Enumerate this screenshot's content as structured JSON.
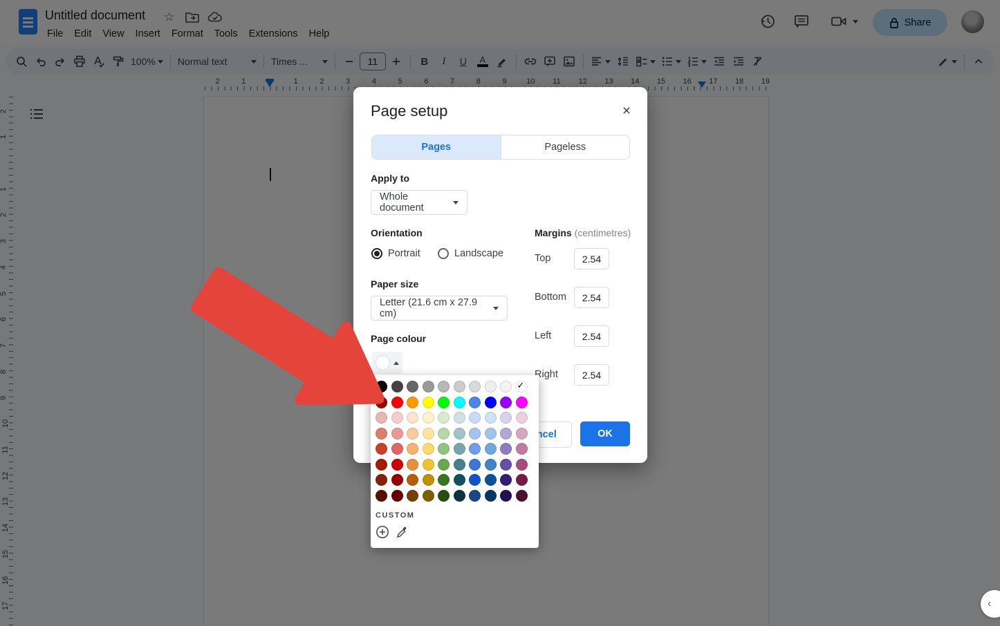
{
  "header": {
    "doc_title": "Untitled document",
    "menus": [
      "File",
      "Edit",
      "View",
      "Insert",
      "Format",
      "Tools",
      "Extensions",
      "Help"
    ],
    "share_label": "Share"
  },
  "toolbar": {
    "zoom_value": "100%",
    "paragraph_style": "Normal text",
    "font_family": "Times ...",
    "font_size": "11",
    "bold": "B",
    "italic": "I",
    "underline": "U",
    "text_color": "A"
  },
  "ruler": {
    "horizontal_left": [
      "2",
      "1"
    ],
    "horizontal_right": [
      "1",
      "2",
      "3",
      "4",
      "5",
      "6",
      "7",
      "8",
      "9",
      "10",
      "11",
      "12",
      "13",
      "14",
      "15",
      "16",
      "17",
      "18",
      "19"
    ],
    "vertical_top": [
      "2",
      "1"
    ],
    "vertical_body": [
      "1",
      "2",
      "3",
      "4",
      "5",
      "6",
      "7",
      "8",
      "9",
      "10",
      "11",
      "12",
      "13",
      "14",
      "15",
      "16",
      "17"
    ]
  },
  "dialog": {
    "title": "Page setup",
    "tabs": [
      {
        "label": "Pages",
        "active": true
      },
      {
        "label": "Pageless",
        "active": false
      }
    ],
    "apply_to_label": "Apply to",
    "apply_to_value": "Whole document",
    "orientation_label": "Orientation",
    "orientation_options": [
      {
        "label": "Portrait",
        "selected": true
      },
      {
        "label": "Landscape",
        "selected": false
      }
    ],
    "paper_size_label": "Paper size",
    "paper_size_value": "Letter (21.6 cm x 27.9 cm)",
    "page_colour_label": "Page colour",
    "page_colour_selected": "#ffffff",
    "margins_label": "Margins",
    "margins_unit": "(centimetres)",
    "margins": [
      {
        "label": "Top",
        "value": "2.54"
      },
      {
        "label": "Bottom",
        "value": "2.54"
      },
      {
        "label": "Left",
        "value": "2.54"
      },
      {
        "label": "Right",
        "value": "2.54"
      }
    ],
    "cancel_label": "Cancel",
    "ok_label": "OK"
  },
  "color_picker": {
    "custom_label": "CUSTOM",
    "selected_row": 0,
    "selected_col": 9,
    "rows": [
      [
        "#000000",
        "#434343",
        "#666666",
        "#999999",
        "#b7b7b7",
        "#cccccc",
        "#d9d9d9",
        "#efefef",
        "#f3f3f3",
        "#ffffff"
      ],
      [
        "#980000",
        "#ff0000",
        "#ff9900",
        "#ffff00",
        "#00ff00",
        "#00ffff",
        "#4a86e8",
        "#0000ff",
        "#9900ff",
        "#ff00ff"
      ],
      [
        "#e6b8af",
        "#f4cccc",
        "#fce5cd",
        "#fff2cc",
        "#d9ead3",
        "#d0e0e3",
        "#c9daf8",
        "#cfe2f3",
        "#d9d2e9",
        "#ead1dc"
      ],
      [
        "#dd7e6b",
        "#ea9999",
        "#f9cb9c",
        "#ffe599",
        "#b6d7a8",
        "#a2c4c9",
        "#a4c2f4",
        "#9fc5e8",
        "#b4a7d6",
        "#d5a6bd"
      ],
      [
        "#cc4125",
        "#e06666",
        "#f6b26b",
        "#ffd966",
        "#93c47d",
        "#76a5af",
        "#6d9eeb",
        "#6fa8dc",
        "#8e7cc3",
        "#c27ba0"
      ],
      [
        "#a61c00",
        "#cc0000",
        "#e69138",
        "#f1c232",
        "#6aa84f",
        "#45818e",
        "#3c78d8",
        "#3d85c6",
        "#674ea7",
        "#a64d79"
      ],
      [
        "#85200c",
        "#990000",
        "#b45f06",
        "#bf9000",
        "#38761d",
        "#134f5c",
        "#1155cc",
        "#0b5394",
        "#351c75",
        "#741b47"
      ],
      [
        "#5b0f00",
        "#660000",
        "#783f04",
        "#7f6000",
        "#274e13",
        "#0c343d",
        "#1c4587",
        "#073763",
        "#20124d",
        "#4c1130"
      ]
    ]
  },
  "annotation": {
    "arrow_color": "#e5443b"
  },
  "theme": {
    "accent_blue": "#1a73e8",
    "active_tab_bg": "#dce9fc",
    "share_bg": "#c2e7ff",
    "toolbar_bg": "#edf2fa",
    "overlay": "rgba(0,0,0,0.52)"
  },
  "icons": {
    "close": "×",
    "check": "✓",
    "star": "☆",
    "collapse_chevron": "‹"
  }
}
